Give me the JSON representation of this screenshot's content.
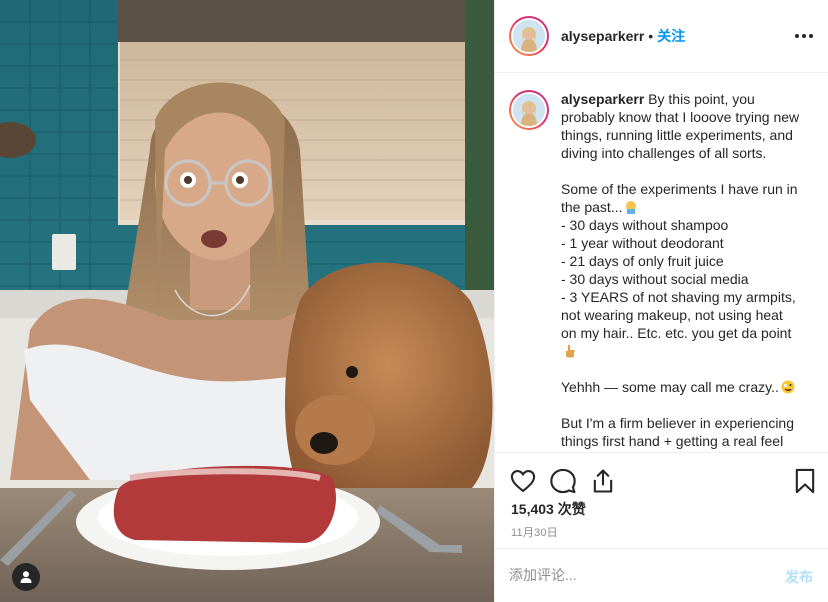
{
  "post": {
    "username": "alyseparkerr",
    "dot": "•",
    "follow_label": "关注",
    "caption_lines": [
      " By this point, you probably know that I looove trying new things, running little experiments, and diving into challenges of all sorts.",
      "",
      "Some of the experiments I have run in the past...",
      "- 30 days without shampoo",
      "- 1 year without deodorant",
      "- 21 days of only fruit juice",
      "- 30 days without social media",
      "- 3 YEARS of not shaving my armpits, not wearing makeup, not using heat on my hair.. Etc. etc. you get da point",
      "",
      "Yehhh — some may call me crazy..",
      "",
      "But I'm a firm believer in experiencing things first hand + getting a real feel"
    ],
    "likes_label": "15,403 次赞",
    "date_label": "11月30日"
  },
  "comment": {
    "placeholder": "添加评论...",
    "post_label": "发布"
  },
  "colors": {
    "accent": "#0095f6",
    "post_disabled": "#b2dffc",
    "border": "#efefef",
    "muted": "#8e8e8e"
  },
  "icons": [
    "user-tag-icon",
    "more-options-icon",
    "heart-icon",
    "comment-icon",
    "share-icon",
    "bookmark-icon"
  ]
}
